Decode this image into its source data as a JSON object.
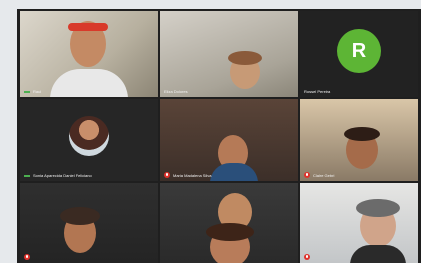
{
  "participants": [
    {
      "name": "Raul",
      "initial": "",
      "muted": false
    },
    {
      "name": "Eliza Dolores",
      "initial": "",
      "muted": false
    },
    {
      "name": "Rossel Pereira",
      "initial": "R",
      "muted": false
    },
    {
      "name": "Sonia Aparecida Daniel Feliciano",
      "initial": "",
      "muted": false
    },
    {
      "name": "Maria Madalena Silva",
      "initial": "",
      "muted": true
    },
    {
      "name": "Claire Gebri",
      "initial": "",
      "muted": true
    },
    {
      "name": "",
      "initial": "",
      "muted": true
    },
    {
      "name": "",
      "initial": "",
      "muted": false
    },
    {
      "name": "",
      "initial": "",
      "muted": true
    },
    {
      "name": "",
      "initial": "",
      "muted": false
    }
  ],
  "colors": {
    "avatar_green": "#5db535",
    "muted_red": "#e0312b",
    "tile_bg": "#2b2b2b"
  }
}
